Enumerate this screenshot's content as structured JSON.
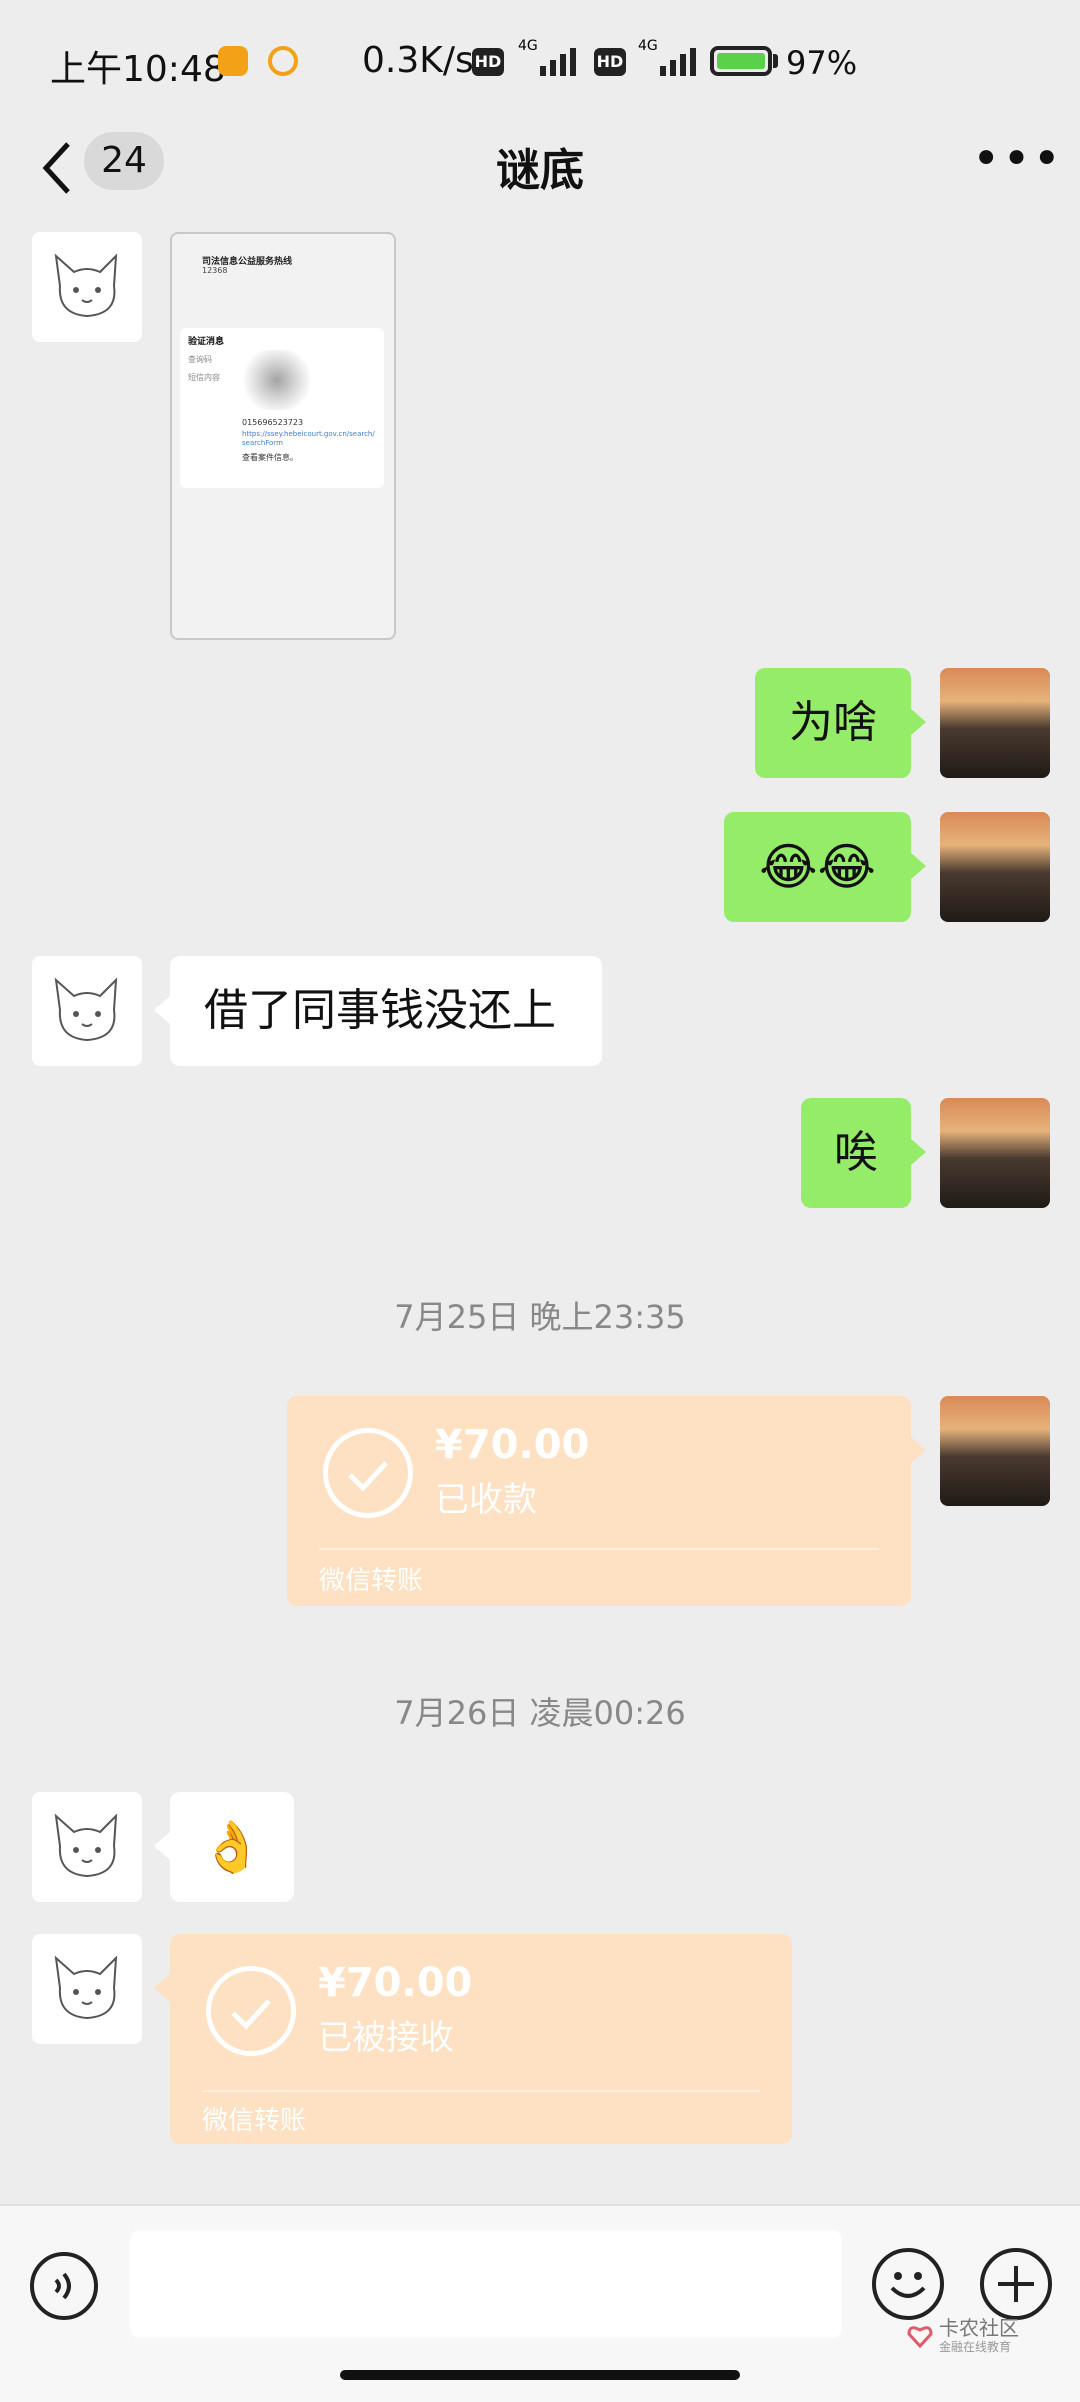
{
  "status_bar": {
    "time": "上午10:48",
    "network_speed": "0.3K/s",
    "hd1": "HD",
    "hd2": "HD",
    "net_type1": "4G",
    "net_type2": "4G",
    "battery": "97%"
  },
  "header": {
    "unread_count": "24",
    "title": "谜底"
  },
  "messages": {
    "m1_text": "为啥",
    "m2_emoji": "😂😂",
    "m3_text": "借了同事钱没还上",
    "m4_text": "唉",
    "stamp1": "7月25日 晚上23:35",
    "transfer1": {
      "amount": "¥70.00",
      "state": "已收款",
      "label": "微信转账"
    },
    "stamp2": "7月26日 凌晨00:26",
    "m5_emoji": "👌",
    "transfer2": {
      "amount": "¥70.00",
      "state": "已被接收",
      "label": "微信转账"
    }
  },
  "screenshot_msg": {
    "app_title": "司法信息公益服务热线",
    "app_number": "12368",
    "section": "验证消息",
    "row1": "查询码",
    "row2": "短信内容",
    "link": "https://ssey.hebeicourt.gov.cn/search/searchForm",
    "code": "015696523723",
    "tail": "查看案件信息。"
  },
  "watermark": {
    "line1": "卡农社区",
    "line2": "金融在线教育"
  },
  "colors": {
    "sent_bubble": "#95ec69",
    "transfer": "#fde1c2",
    "background": "#ededed"
  }
}
